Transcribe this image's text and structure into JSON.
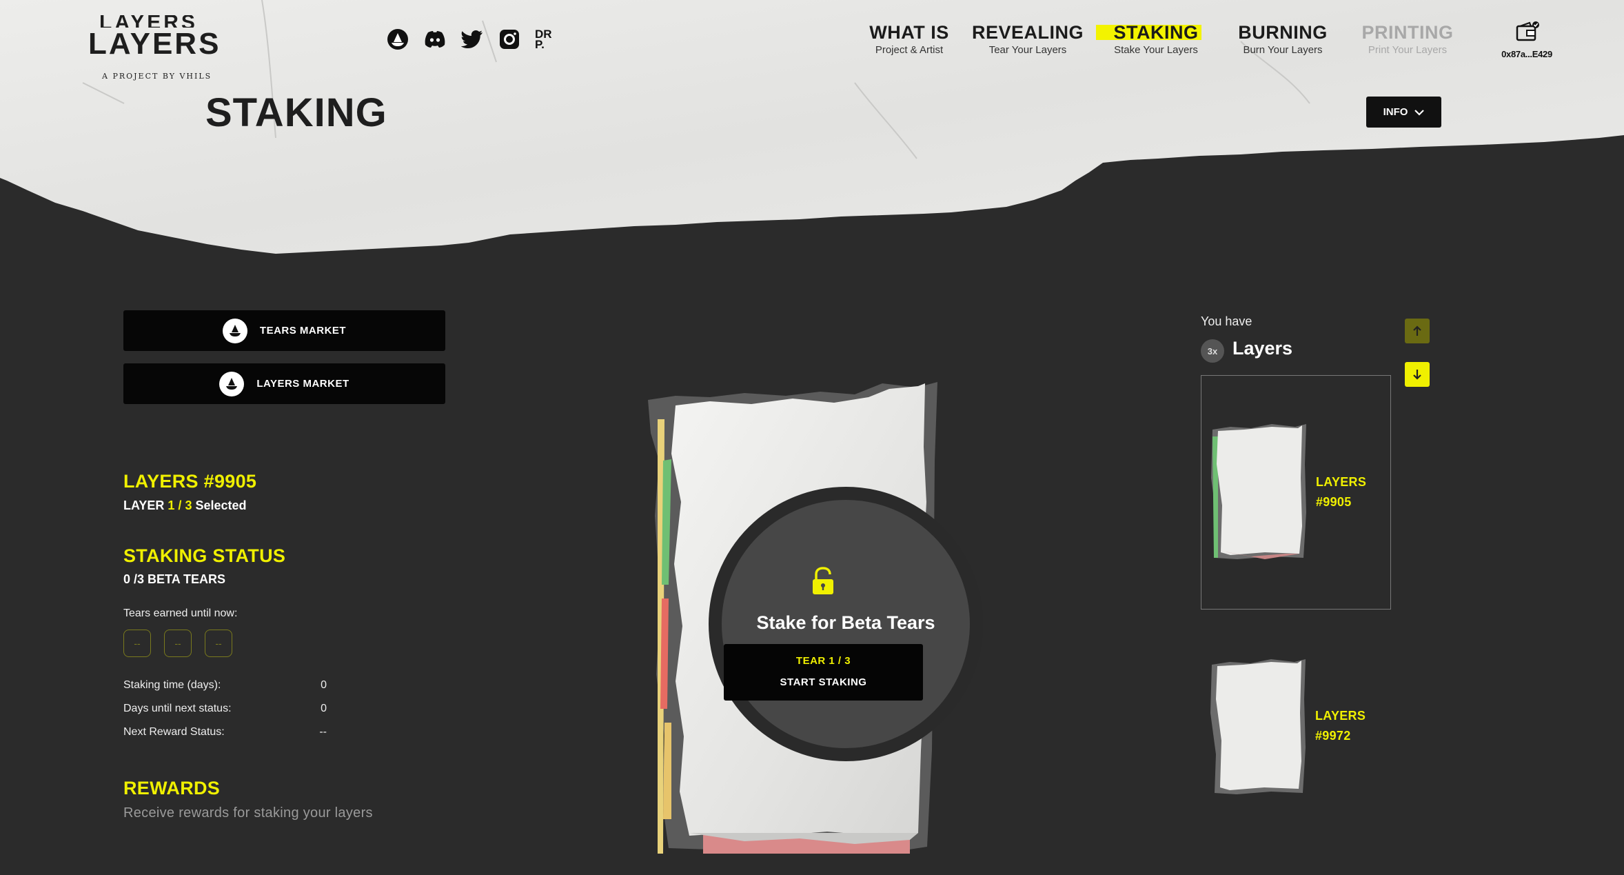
{
  "brand": {
    "logo_ghost": "LAYERS",
    "logo_text": "LAYERS",
    "logo_subtitle": "A PROJECT BY VHILS"
  },
  "social": [
    {
      "name": "opensea-icon"
    },
    {
      "name": "discord-icon"
    },
    {
      "name": "twitter-icon"
    },
    {
      "name": "instagram-icon"
    }
  ],
  "social_drp": "DR P.",
  "nav": [
    {
      "title": "WHAT IS",
      "subtitle": "Project & Artist",
      "state": "normal"
    },
    {
      "title": "REVEALING",
      "subtitle": "Tear Your Layers",
      "state": "normal"
    },
    {
      "title": "STAKING",
      "subtitle": "Stake Your Layers",
      "state": "active"
    },
    {
      "title": "BURNING",
      "subtitle": "Burn Your Layers",
      "state": "normal"
    },
    {
      "title": "PRINTING",
      "subtitle": "Print Your Layers",
      "state": "disabled"
    }
  ],
  "wallet": {
    "address": "0x87a...E429",
    "icon": "wallet-check-icon"
  },
  "page_title": "STAKING",
  "info_button": "INFO",
  "markets": {
    "tears": "TEARS MARKET",
    "layers": "LAYERS MARKET"
  },
  "selection": {
    "layer_title": "LAYERS #9905",
    "layer_prefix": "LAYER",
    "current": "1",
    "sep": "/",
    "total": "3",
    "selected_suffix": "Selected"
  },
  "staking_status": {
    "title": "STAKING STATUS",
    "beta_tears": "0 /3 BETA TEARS",
    "tears_earned_label": "Tears earned until now:",
    "tear_slots": [
      "--",
      "--",
      "--"
    ],
    "stats": [
      {
        "label": "Staking time (days):",
        "value": "0"
      },
      {
        "label": "Days until next status:",
        "value": "0"
      },
      {
        "label": "Next Reward Status:",
        "value": "--"
      }
    ]
  },
  "rewards": {
    "title": "REWARDS",
    "description": "Receive rewards for staking your layers"
  },
  "stake_card": {
    "title": "Stake for Beta Tears",
    "tear_line": "TEAR 1 / 3",
    "button_label": "START STAKING",
    "lock_state": "unlocked"
  },
  "inventory": {
    "you_have": "You have",
    "count": "3x",
    "heading": "Layers",
    "items": [
      {
        "line1": "LAYERS",
        "line2": "#9905",
        "selected": true
      },
      {
        "line1": "LAYERS",
        "line2": "#9972",
        "selected": false
      }
    ]
  },
  "colors": {
    "accent": "#f0f000",
    "background": "#2b2b2b",
    "paper": "#e8e8e6",
    "button": "#060606"
  }
}
